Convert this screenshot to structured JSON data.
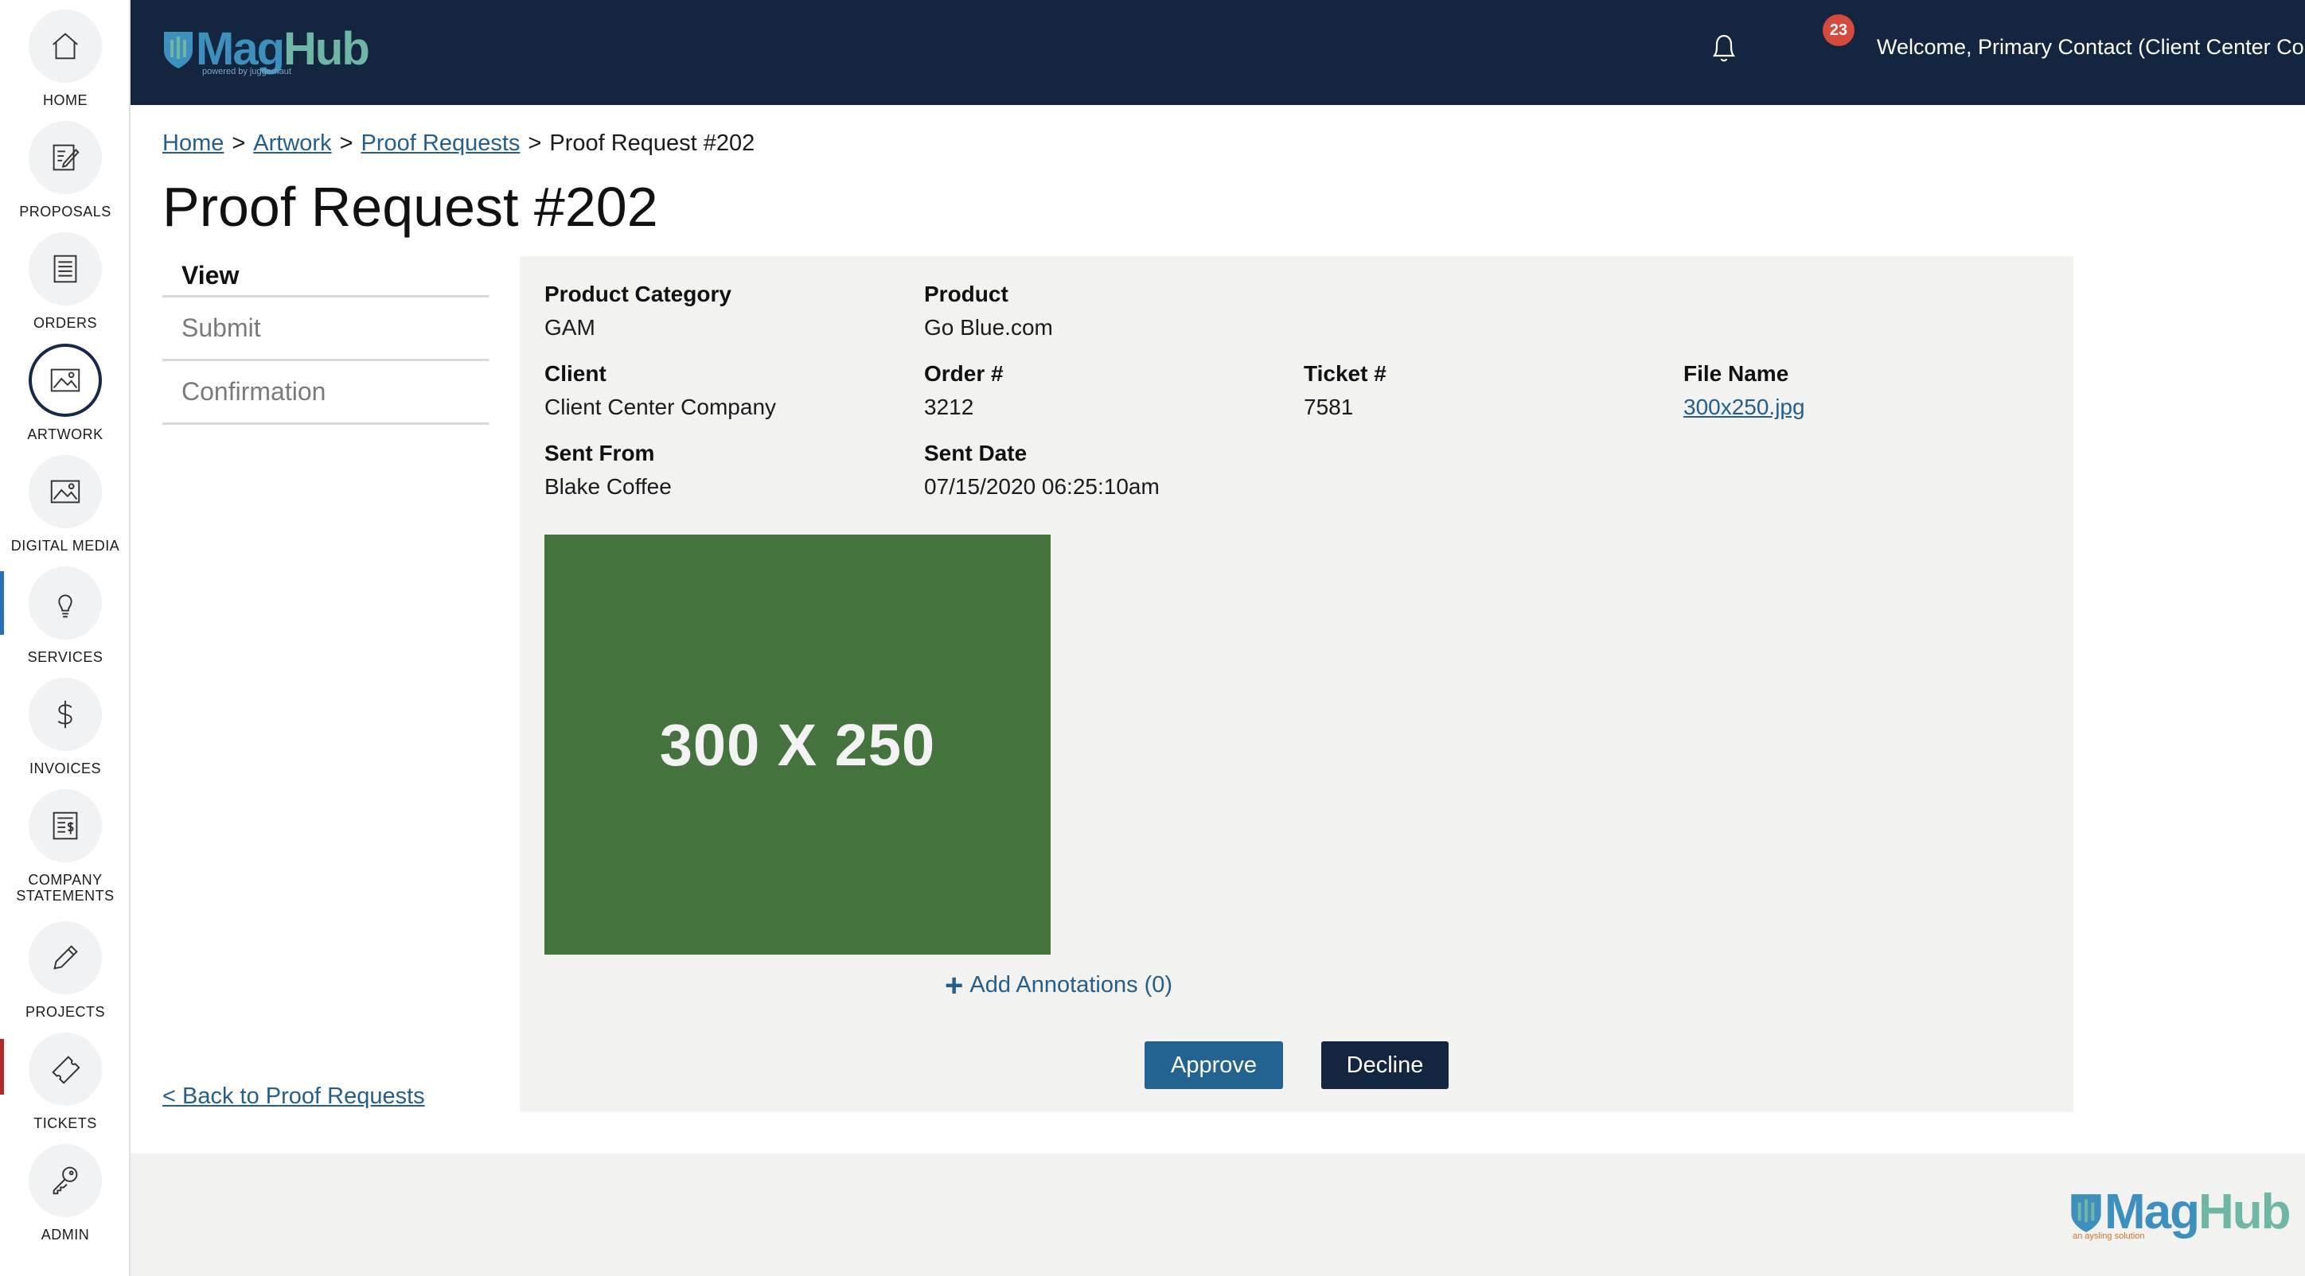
{
  "app": {
    "name": "MagHub",
    "powered_by": "powered by juggernaut",
    "footer_tagline": "an aysling solution"
  },
  "sidebar": {
    "items": [
      {
        "label": "HOME",
        "icon": "home-icon",
        "active": false
      },
      {
        "label": "PROPOSALS",
        "icon": "proposal-edit-icon",
        "active": false
      },
      {
        "label": "ORDERS",
        "icon": "document-lines-icon",
        "active": false
      },
      {
        "label": "ARTWORK",
        "icon": "image-icon",
        "active": true
      },
      {
        "label": "DIGITAL MEDIA",
        "icon": "image-icon",
        "active": false
      },
      {
        "label": "SERVICES",
        "icon": "lightbulb-icon",
        "active": false
      },
      {
        "label": "INVOICES",
        "icon": "dollar-icon",
        "active": false
      },
      {
        "label": "COMPANY STATEMENTS",
        "icon": "statement-icon",
        "active": false
      },
      {
        "label": "PROJECTS",
        "icon": "pencil-icon",
        "active": false
      },
      {
        "label": "TICKETS",
        "icon": "ticket-icon",
        "active": false
      },
      {
        "label": "ADMIN",
        "icon": "key-icon",
        "active": false
      }
    ]
  },
  "header": {
    "notifications": "23",
    "welcome": "Welcome, Primary Contact (Client Center Company)"
  },
  "breadcrumb": {
    "home": "Home",
    "artwork": "Artwork",
    "proof_requests": "Proof Requests",
    "current": "Proof Request #202",
    "separator": ">"
  },
  "page": {
    "title": "Proof Request #202"
  },
  "steps": [
    "View",
    "Submit",
    "Confirmation"
  ],
  "back_link": "< Back to Proof Requests",
  "details": {
    "product_category": {
      "label": "Product Category",
      "value": "GAM"
    },
    "product": {
      "label": "Product",
      "value": "Go Blue.com"
    },
    "client": {
      "label": "Client",
      "value": "Client Center Company"
    },
    "order": {
      "label": "Order #",
      "value": "3212"
    },
    "ticket": {
      "label": "Ticket #",
      "value": "7581"
    },
    "file_name": {
      "label": "File Name",
      "value": "300x250.jpg"
    },
    "sent_from": {
      "label": "Sent From",
      "value": "Blake Coffee"
    },
    "sent_date": {
      "label": "Sent Date",
      "value": "07/15/2020 06:25:10am"
    }
  },
  "preview": {
    "text": "300 X 250",
    "background": "#44733d"
  },
  "annotations": {
    "label": "Add Annotations (0)"
  },
  "actions": {
    "approve": "Approve",
    "decline": "Decline"
  },
  "colors": {
    "header_bg": "#13253f",
    "link": "#245f8c",
    "approve": "#236392",
    "decline": "#13253f",
    "badge": "#d44a3c"
  }
}
